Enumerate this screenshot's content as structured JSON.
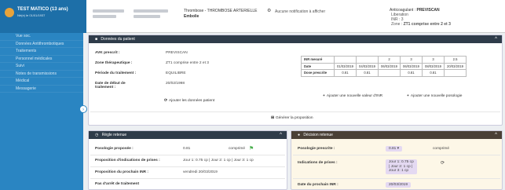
{
  "patient": {
    "name": "TEST MATICO (13 ans)",
    "sub": "Né(e) le 01/01/1937"
  },
  "header": {
    "thrombose_title": "Thrombose",
    "thrombose_value": "THROMBOSE ARTERIELLE",
    "embolie": "Embolie",
    "alert": "Aucune notification à afficher",
    "avk_label": "Anticoagulant :",
    "avk_value": "PREVISCAN",
    "avk_line2": "Liberation",
    "avk_inr_label": "INR :",
    "avk_inr_value": "3",
    "avk_zone_label": "Zone :",
    "avk_zone_value": "ZT1 comprise entre 2 et 3"
  },
  "sidebar": {
    "items": [
      "Vue soc.",
      "Données Antithrombotiques",
      "Traitements",
      "Personnel médicales",
      "Suivi",
      "Notes de transmissions",
      "Médical",
      "Messagerie"
    ]
  },
  "donnees": {
    "title": "Données du patient",
    "rows": [
      {
        "label": "AVK prescrit :",
        "value": "PREVISCAN"
      },
      {
        "label": "Zone thérapeutique :",
        "value": "ZT1 comprise entre 2 et 3"
      },
      {
        "label": "Période du traitement :",
        "value": "EQUILIBRE"
      },
      {
        "label": "Date de début de traitement :",
        "value": "20/02/1998"
      }
    ],
    "update_btn": "Ajouter les données patient",
    "table": {
      "row1_label": "INR mesuré",
      "row1": [
        "",
        "",
        "2",
        "3",
        "3",
        "2.5"
      ],
      "row2_label": "Date",
      "row2": [
        "01/03/2019",
        "04/03/2019",
        "06/03/2019",
        "06/03/2019",
        "08/03/2019",
        "20/03/2019"
      ],
      "row3_label": "Dose prescrite",
      "row3": [
        "0.81",
        "0.81",
        "",
        "0.81",
        "0.81",
        ""
      ]
    },
    "add_inr": "Ajouter une nouvelle valeur d'INR",
    "add_poso": "Ajouter une nouvelle posologie",
    "generate": "Générer la proposition"
  },
  "regle": {
    "title": "Règle retenue",
    "rows": [
      {
        "label": "Posologie proposée :",
        "value": "0.81",
        "extra": "comprimé"
      },
      {
        "label": "Proposition d'indications de prises :",
        "value": "Jour 1: 0.75 cp | Jour 2: 1 cp | Jour 3: 1 cp"
      },
      {
        "label": "Proposition du prochain INR :",
        "value": "vendredi 20/03/2019"
      },
      {
        "label": "Pas d'arrêt de traitement",
        "value": ""
      }
    ]
  },
  "decision": {
    "title": "Décision retenue",
    "rows": [
      {
        "label": "Posologie prescrite :",
        "value": "0.81 ▾",
        "extra": "comprimé"
      },
      {
        "label": "Indications de prises :",
        "value": "Jour 1: 0.75 cp | Jour 2: 1 cp | Jour 3: 1 cp"
      },
      {
        "label": "Date du prochain INR :",
        "value": "20/03/2019"
      }
    ]
  },
  "colors": {
    "sidebar": "#2a85c2",
    "header_dark": "#2f3c4a",
    "name_bg": "#1d6fa8",
    "flag": "#4caf50"
  }
}
